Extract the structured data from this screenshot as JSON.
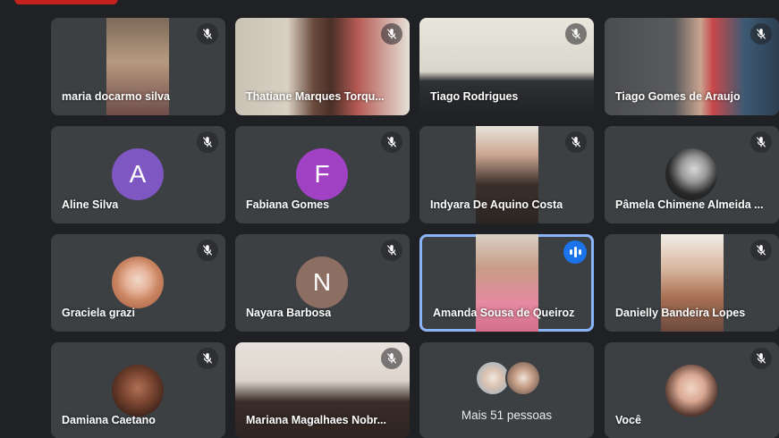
{
  "app": "Google Meet",
  "colors": {
    "background": "#202124",
    "tile": "#3c4043",
    "active_border": "#8ab4f8",
    "speaking_indicator": "#1a73e8"
  },
  "participants": [
    {
      "name": "maria docarmo silva",
      "mic": "muted",
      "display": "video"
    },
    {
      "name": "Thatiane Marques Torqu...",
      "mic": "muted",
      "display": "video"
    },
    {
      "name": "Tiago Rodrigues",
      "mic": "muted",
      "display": "video"
    },
    {
      "name": "Tiago Gomes de Araujo",
      "mic": "muted",
      "display": "video"
    },
    {
      "name": "Aline Silva",
      "mic": "muted",
      "display": "letter-avatar",
      "initial": "A",
      "avatar_color": "#7e57c2"
    },
    {
      "name": "Fabiana Gomes",
      "mic": "muted",
      "display": "letter-avatar",
      "initial": "F",
      "avatar_color": "#a142c4"
    },
    {
      "name": "Indyara De Aquino Costa",
      "mic": "muted",
      "display": "video"
    },
    {
      "name": "Pâmela Chimene Almeida ...",
      "mic": "muted",
      "display": "photo-avatar"
    },
    {
      "name": "Graciela grazi",
      "mic": "muted",
      "display": "photo-avatar"
    },
    {
      "name": "Nayara Barbosa",
      "mic": "muted",
      "display": "letter-avatar",
      "initial": "N",
      "avatar_color": "#8d6e63"
    },
    {
      "name": "Amanda Sousa de Queiroz",
      "mic": "speaking",
      "display": "video"
    },
    {
      "name": "Danielly Bandeira Lopes",
      "mic": "muted",
      "display": "video"
    },
    {
      "name": "Damiana Caetano",
      "mic": "muted",
      "display": "photo-avatar"
    },
    {
      "name": "Mariana Magalhaes Nobr...",
      "mic": "muted",
      "display": "video"
    },
    {
      "name": "Você",
      "mic": "muted",
      "display": "photo-avatar"
    }
  ],
  "overflow_tile": {
    "label": "Mais 51 pessoas"
  }
}
